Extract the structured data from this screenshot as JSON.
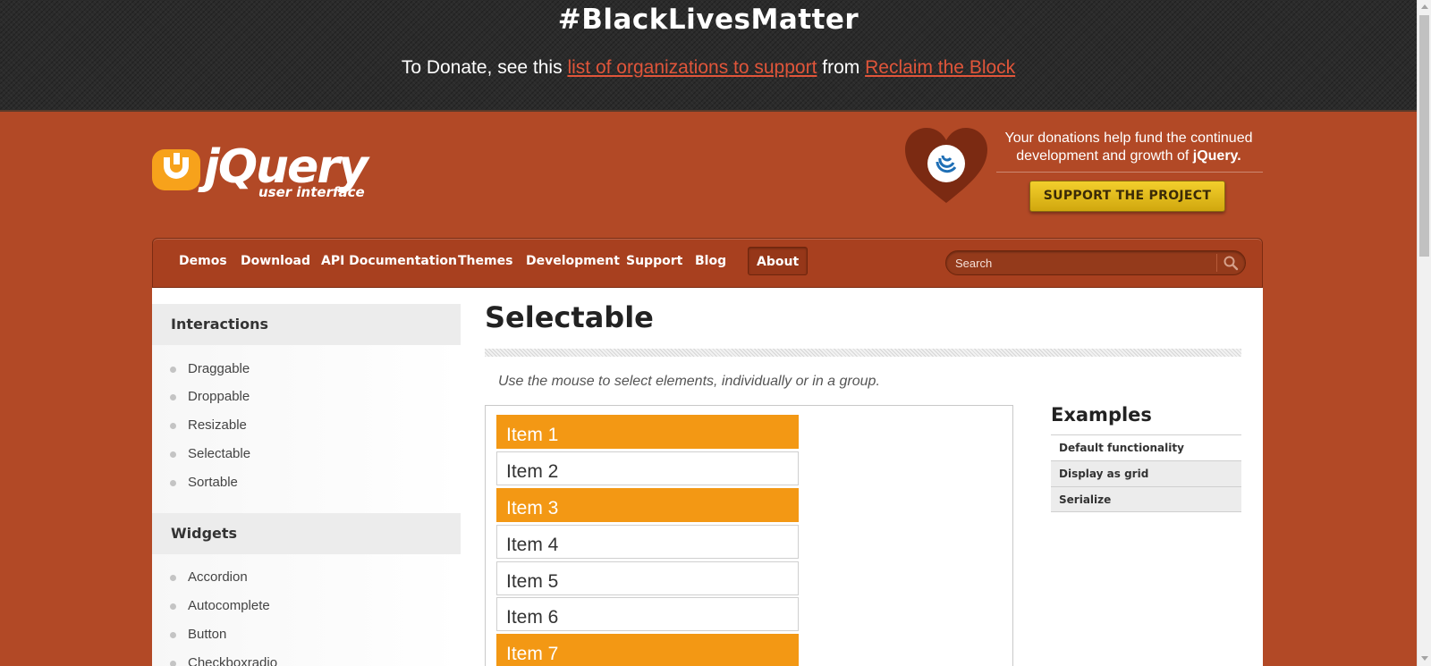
{
  "banner": {
    "title": "#BlackLivesMatter",
    "prefix": "To Donate, see this ",
    "link1": "list of organizations to support",
    "middle": " from ",
    "link2": "Reclaim the Block"
  },
  "header": {
    "logo_text": "jQuery",
    "logo_subtext": "user interface",
    "donate_text": "Your donations help fund the continued development and growth of ",
    "donate_brand": "jQuery.",
    "support_button": "SUPPORT THE PROJECT"
  },
  "nav": {
    "items": [
      {
        "label": "Demos"
      },
      {
        "label": "Download"
      },
      {
        "label": "API Documentation"
      },
      {
        "label": "Themes"
      },
      {
        "label": "Development"
      },
      {
        "label": "Support"
      },
      {
        "label": "Blog"
      },
      {
        "label": "About",
        "active": true
      }
    ],
    "search_placeholder": "Search"
  },
  "sidebar": {
    "sections": [
      {
        "title": "Interactions",
        "items": [
          "Draggable",
          "Droppable",
          "Resizable",
          "Selectable",
          "Sortable"
        ]
      },
      {
        "title": "Widgets",
        "items": [
          "Accordion",
          "Autocomplete",
          "Button",
          "Checkboxradio"
        ]
      }
    ]
  },
  "main": {
    "title": "Selectable",
    "description": "Use the mouse to select elements, individually or in a group.",
    "selectable_items": [
      {
        "label": "Item 1",
        "selected": true
      },
      {
        "label": "Item 2",
        "selected": false
      },
      {
        "label": "Item 3",
        "selected": true
      },
      {
        "label": "Item 4",
        "selected": false
      },
      {
        "label": "Item 5",
        "selected": false
      },
      {
        "label": "Item 6",
        "selected": false
      },
      {
        "label": "Item 7",
        "selected": true
      }
    ],
    "examples_title": "Examples",
    "examples": [
      "Default functionality",
      "Display as grid",
      "Serialize"
    ]
  },
  "colors": {
    "accent": "#b24926",
    "selected": "#f39814",
    "link": "#e0553a",
    "button": "#e8c11f"
  }
}
